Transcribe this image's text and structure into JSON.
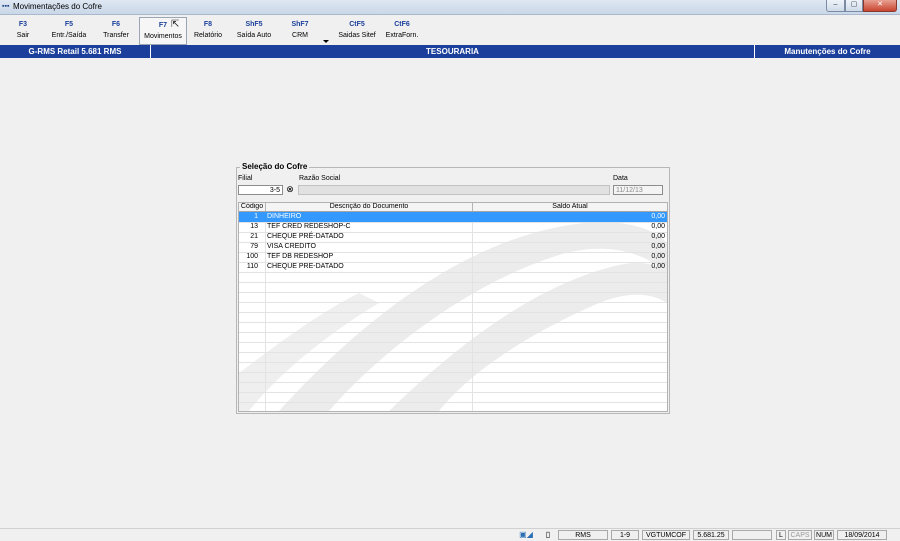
{
  "window": {
    "title": "Movimentações do Cofre",
    "min": "–",
    "max": "▢",
    "close": "✕"
  },
  "toolbar": [
    {
      "key": "F3",
      "label": "Sair"
    },
    {
      "key": "F5",
      "label": "Entr./Saída"
    },
    {
      "key": "F6",
      "label": "Transfer"
    },
    {
      "key": "F7",
      "label": "Movimentos"
    },
    {
      "key": "F8",
      "label": "Relatório"
    },
    {
      "key": "ShF5",
      "label": "Saída Auto"
    },
    {
      "key": "ShF7",
      "label": "CRM"
    },
    {
      "key": "CtF5",
      "label": "Saidas Sitef"
    },
    {
      "key": "CtF6",
      "label": "ExtraForn."
    }
  ],
  "header": {
    "app": "G-RMS Retail 5.681 RMS",
    "module": "TESOURARIA",
    "screen": "Manutenções do Cofre"
  },
  "selection": {
    "title": "Seleção do Cofre",
    "filial_label": "Filial",
    "filial_value": "3-5",
    "razao_label": "Razão Social",
    "razao_value": "",
    "data_label": "Data",
    "data_value": "11/12/13"
  },
  "grid": {
    "columns": [
      "Código",
      "Descrição do Documento",
      "Saldo Atual"
    ],
    "rows": [
      {
        "code": "1",
        "desc": "DINHEIRO",
        "saldo": "0,00",
        "selected": true
      },
      {
        "code": "13",
        "desc": "TEF CRED REDESHOP-C",
        "saldo": "0,00"
      },
      {
        "code": "21",
        "desc": "CHEQUE PRÉ-DATADO",
        "saldo": "0,00"
      },
      {
        "code": "79",
        "desc": "VISA CREDITO",
        "saldo": "0,00"
      },
      {
        "code": "100",
        "desc": "TEF DB REDESHOP",
        "saldo": "0,00"
      },
      {
        "code": "110",
        "desc": "CHEQUE PRE-DATADO",
        "saldo": "0,00"
      }
    ]
  },
  "status": {
    "rms": "RMS",
    "range": "1-9",
    "program": "VGTUMCOF",
    "version": "5.681.25",
    "l": "L",
    "caps": "CAPS",
    "num": "NUM",
    "date": "18/09/2014"
  },
  "colors": {
    "header_blue": "#1b3f9b",
    "key_blue": "#1a3f9c",
    "selection_blue": "#3399ff"
  }
}
